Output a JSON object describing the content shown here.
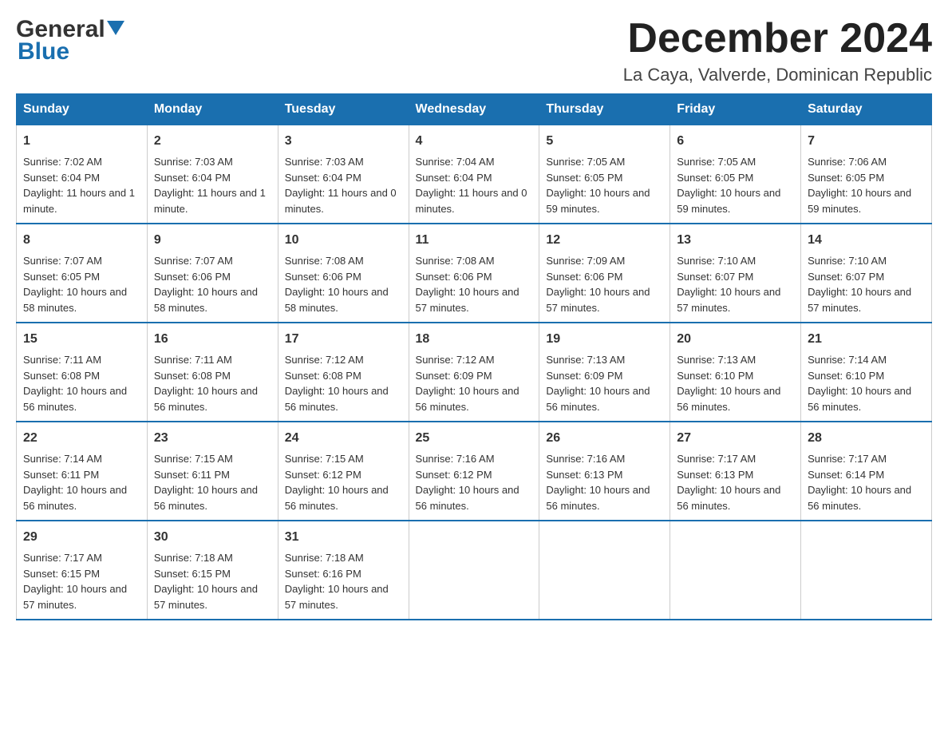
{
  "header": {
    "logo_general": "General",
    "logo_blue": "Blue",
    "month_title": "December 2024",
    "location": "La Caya, Valverde, Dominican Republic"
  },
  "days_of_week": [
    "Sunday",
    "Monday",
    "Tuesday",
    "Wednesday",
    "Thursday",
    "Friday",
    "Saturday"
  ],
  "weeks": [
    [
      {
        "day": "1",
        "sunrise": "Sunrise: 7:02 AM",
        "sunset": "Sunset: 6:04 PM",
        "daylight": "Daylight: 11 hours and 1 minute."
      },
      {
        "day": "2",
        "sunrise": "Sunrise: 7:03 AM",
        "sunset": "Sunset: 6:04 PM",
        "daylight": "Daylight: 11 hours and 1 minute."
      },
      {
        "day": "3",
        "sunrise": "Sunrise: 7:03 AM",
        "sunset": "Sunset: 6:04 PM",
        "daylight": "Daylight: 11 hours and 0 minutes."
      },
      {
        "day": "4",
        "sunrise": "Sunrise: 7:04 AM",
        "sunset": "Sunset: 6:04 PM",
        "daylight": "Daylight: 11 hours and 0 minutes."
      },
      {
        "day": "5",
        "sunrise": "Sunrise: 7:05 AM",
        "sunset": "Sunset: 6:05 PM",
        "daylight": "Daylight: 10 hours and 59 minutes."
      },
      {
        "day": "6",
        "sunrise": "Sunrise: 7:05 AM",
        "sunset": "Sunset: 6:05 PM",
        "daylight": "Daylight: 10 hours and 59 minutes."
      },
      {
        "day": "7",
        "sunrise": "Sunrise: 7:06 AM",
        "sunset": "Sunset: 6:05 PM",
        "daylight": "Daylight: 10 hours and 59 minutes."
      }
    ],
    [
      {
        "day": "8",
        "sunrise": "Sunrise: 7:07 AM",
        "sunset": "Sunset: 6:05 PM",
        "daylight": "Daylight: 10 hours and 58 minutes."
      },
      {
        "day": "9",
        "sunrise": "Sunrise: 7:07 AM",
        "sunset": "Sunset: 6:06 PM",
        "daylight": "Daylight: 10 hours and 58 minutes."
      },
      {
        "day": "10",
        "sunrise": "Sunrise: 7:08 AM",
        "sunset": "Sunset: 6:06 PM",
        "daylight": "Daylight: 10 hours and 58 minutes."
      },
      {
        "day": "11",
        "sunrise": "Sunrise: 7:08 AM",
        "sunset": "Sunset: 6:06 PM",
        "daylight": "Daylight: 10 hours and 57 minutes."
      },
      {
        "day": "12",
        "sunrise": "Sunrise: 7:09 AM",
        "sunset": "Sunset: 6:06 PM",
        "daylight": "Daylight: 10 hours and 57 minutes."
      },
      {
        "day": "13",
        "sunrise": "Sunrise: 7:10 AM",
        "sunset": "Sunset: 6:07 PM",
        "daylight": "Daylight: 10 hours and 57 minutes."
      },
      {
        "day": "14",
        "sunrise": "Sunrise: 7:10 AM",
        "sunset": "Sunset: 6:07 PM",
        "daylight": "Daylight: 10 hours and 57 minutes."
      }
    ],
    [
      {
        "day": "15",
        "sunrise": "Sunrise: 7:11 AM",
        "sunset": "Sunset: 6:08 PM",
        "daylight": "Daylight: 10 hours and 56 minutes."
      },
      {
        "day": "16",
        "sunrise": "Sunrise: 7:11 AM",
        "sunset": "Sunset: 6:08 PM",
        "daylight": "Daylight: 10 hours and 56 minutes."
      },
      {
        "day": "17",
        "sunrise": "Sunrise: 7:12 AM",
        "sunset": "Sunset: 6:08 PM",
        "daylight": "Daylight: 10 hours and 56 minutes."
      },
      {
        "day": "18",
        "sunrise": "Sunrise: 7:12 AM",
        "sunset": "Sunset: 6:09 PM",
        "daylight": "Daylight: 10 hours and 56 minutes."
      },
      {
        "day": "19",
        "sunrise": "Sunrise: 7:13 AM",
        "sunset": "Sunset: 6:09 PM",
        "daylight": "Daylight: 10 hours and 56 minutes."
      },
      {
        "day": "20",
        "sunrise": "Sunrise: 7:13 AM",
        "sunset": "Sunset: 6:10 PM",
        "daylight": "Daylight: 10 hours and 56 minutes."
      },
      {
        "day": "21",
        "sunrise": "Sunrise: 7:14 AM",
        "sunset": "Sunset: 6:10 PM",
        "daylight": "Daylight: 10 hours and 56 minutes."
      }
    ],
    [
      {
        "day": "22",
        "sunrise": "Sunrise: 7:14 AM",
        "sunset": "Sunset: 6:11 PM",
        "daylight": "Daylight: 10 hours and 56 minutes."
      },
      {
        "day": "23",
        "sunrise": "Sunrise: 7:15 AM",
        "sunset": "Sunset: 6:11 PM",
        "daylight": "Daylight: 10 hours and 56 minutes."
      },
      {
        "day": "24",
        "sunrise": "Sunrise: 7:15 AM",
        "sunset": "Sunset: 6:12 PM",
        "daylight": "Daylight: 10 hours and 56 minutes."
      },
      {
        "day": "25",
        "sunrise": "Sunrise: 7:16 AM",
        "sunset": "Sunset: 6:12 PM",
        "daylight": "Daylight: 10 hours and 56 minutes."
      },
      {
        "day": "26",
        "sunrise": "Sunrise: 7:16 AM",
        "sunset": "Sunset: 6:13 PM",
        "daylight": "Daylight: 10 hours and 56 minutes."
      },
      {
        "day": "27",
        "sunrise": "Sunrise: 7:17 AM",
        "sunset": "Sunset: 6:13 PM",
        "daylight": "Daylight: 10 hours and 56 minutes."
      },
      {
        "day": "28",
        "sunrise": "Sunrise: 7:17 AM",
        "sunset": "Sunset: 6:14 PM",
        "daylight": "Daylight: 10 hours and 56 minutes."
      }
    ],
    [
      {
        "day": "29",
        "sunrise": "Sunrise: 7:17 AM",
        "sunset": "Sunset: 6:15 PM",
        "daylight": "Daylight: 10 hours and 57 minutes."
      },
      {
        "day": "30",
        "sunrise": "Sunrise: 7:18 AM",
        "sunset": "Sunset: 6:15 PM",
        "daylight": "Daylight: 10 hours and 57 minutes."
      },
      {
        "day": "31",
        "sunrise": "Sunrise: 7:18 AM",
        "sunset": "Sunset: 6:16 PM",
        "daylight": "Daylight: 10 hours and 57 minutes."
      },
      null,
      null,
      null,
      null
    ]
  ]
}
